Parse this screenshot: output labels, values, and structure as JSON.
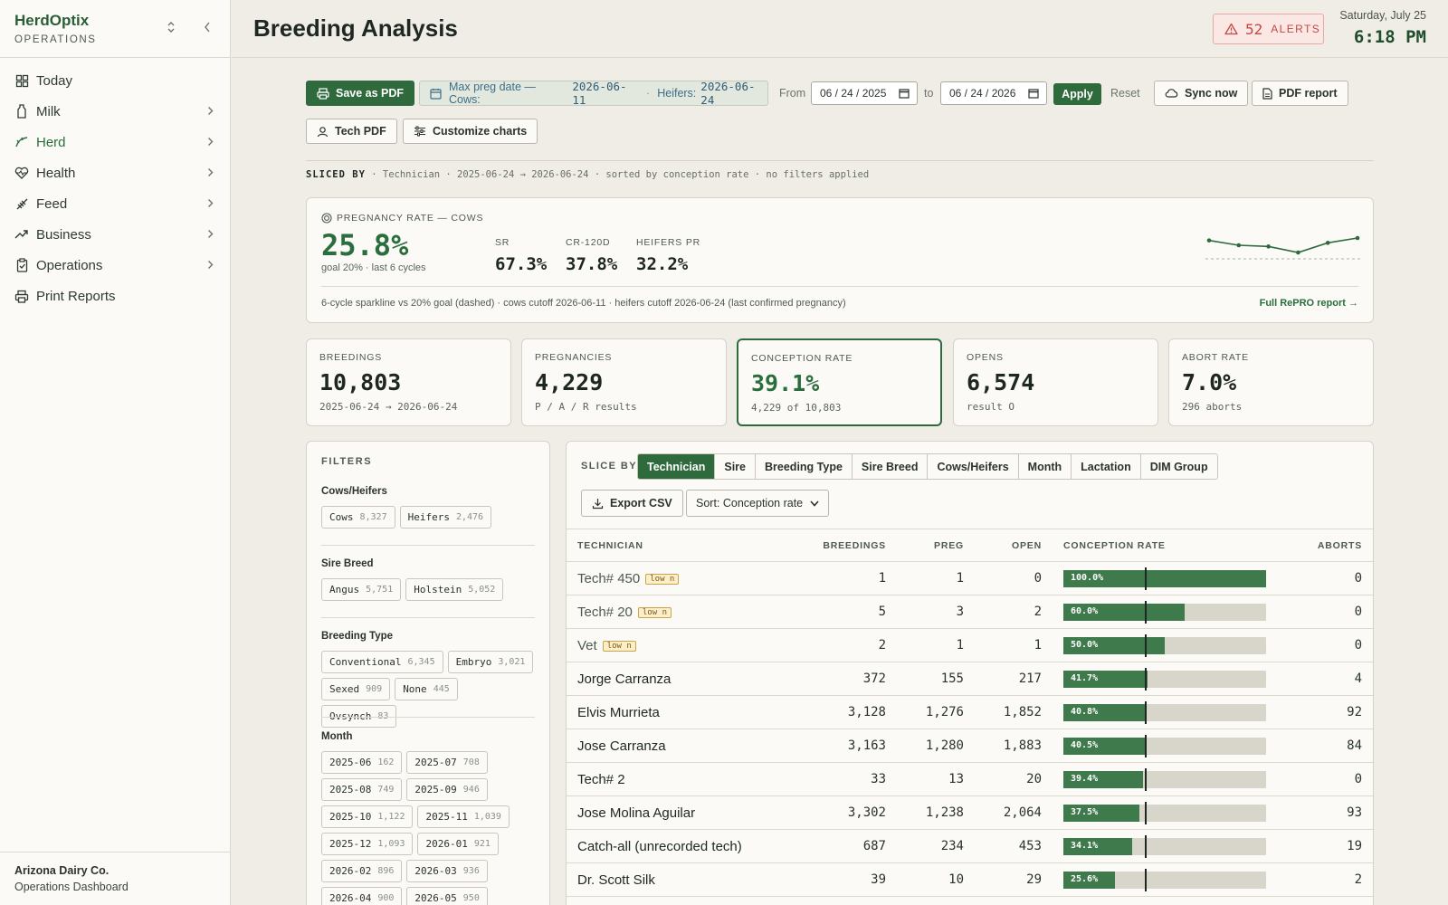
{
  "brand": {
    "name": "HerdOptix",
    "sub": "OPERATIONS"
  },
  "nav": [
    {
      "label": "Today",
      "icon": "layout-icon",
      "chevron": false,
      "active": false
    },
    {
      "label": "Milk",
      "icon": "milk-bottle-icon",
      "chevron": true,
      "active": false
    },
    {
      "label": "Herd",
      "icon": "herd-icon",
      "chevron": true,
      "active": true
    },
    {
      "label": "Health",
      "icon": "heart-pulse-icon",
      "chevron": true,
      "active": false
    },
    {
      "label": "Feed",
      "icon": "wheat-icon",
      "chevron": true,
      "active": false
    },
    {
      "label": "Business",
      "icon": "trend-up-icon",
      "chevron": true,
      "active": false
    },
    {
      "label": "Operations",
      "icon": "clipboard-check-icon",
      "chevron": true,
      "active": false
    },
    {
      "label": "Print Reports",
      "icon": "printer-icon",
      "chevron": false,
      "active": false
    }
  ],
  "footer": {
    "org": "Arizona Dairy Co.",
    "sub": "Operations Dashboard"
  },
  "header": {
    "title": "Breeding Analysis",
    "alerts_count": "52",
    "alerts_label": "ALERTS",
    "date": "Saturday, July 25",
    "time": "6:18 PM"
  },
  "toolbar": {
    "save_pdf": "Save as PDF",
    "maxpreg_label": "Max preg date — Cows:",
    "maxpreg_cows": "2026-06-11",
    "maxpreg_heifers_label": "Heifers:",
    "maxpreg_heifers": "2026-06-24",
    "from_label": "From",
    "from_value": "06 / 24 / 2025",
    "to_label": "to",
    "to_value": "06 / 24 / 2026",
    "apply": "Apply",
    "reset": "Reset",
    "sync": "Sync now",
    "pdf_report": "PDF report",
    "tech_pdf": "Tech PDF",
    "customize": "Customize charts"
  },
  "slice_caption": {
    "label": "SLICED BY",
    "text": " · Technician · 2025-06-24 → 2026-06-24 · sorted by conception rate · no filters applied"
  },
  "pregnancy": {
    "heading": "PREGNANCY RATE — COWS",
    "value": "25.8%",
    "goal": "goal 20% · last 6 cycles",
    "stats": [
      {
        "k": "SR",
        "v": "67.3%"
      },
      {
        "k": "CR-120D",
        "v": "37.8%"
      },
      {
        "k": "HEIFERS PR",
        "v": "32.2%"
      }
    ],
    "sparkline": [
      25.6,
      25.2,
      25.1,
      24.6,
      25.4,
      25.8
    ],
    "goal_pct": 20,
    "footnote": "6-cycle sparkline vs 20% goal (dashed) · cows cutoff 2026-06-11 · heifers cutoff 2026-06-24 (last confirmed pregnancy)",
    "link": "Full RePRO report →"
  },
  "kpis": [
    {
      "k": "BREEDINGS",
      "v": "10,803",
      "s": "2025-06-24 → 2026-06-24"
    },
    {
      "k": "PREGNANCIES",
      "v": "4,229",
      "s": "P / A / R results"
    },
    {
      "k": "CONCEPTION RATE",
      "v": "39.1%",
      "s": "4,229 of 10,803"
    },
    {
      "k": "OPENS",
      "v": "6,574",
      "s": "result O"
    },
    {
      "k": "ABORT RATE",
      "v": "7.0%",
      "s": "296 aborts"
    }
  ],
  "filters": {
    "title": "FILTERS",
    "sections": [
      {
        "h": "Cows/Heifers",
        "chips": [
          {
            "l": "Cows",
            "n": "8,327"
          },
          {
            "l": "Heifers",
            "n": "2,476"
          }
        ]
      },
      {
        "h": "Sire Breed",
        "chips": [
          {
            "l": "Angus",
            "n": "5,751"
          },
          {
            "l": "Holstein",
            "n": "5,052"
          }
        ]
      },
      {
        "h": "Breeding Type",
        "chips": [
          {
            "l": "Conventional",
            "n": "6,345"
          },
          {
            "l": "Embryo",
            "n": "3,021"
          },
          {
            "l": "Sexed",
            "n": "909"
          },
          {
            "l": "None",
            "n": "445"
          },
          {
            "l": "Ovsynch",
            "n": "83"
          }
        ]
      },
      {
        "h": "Month",
        "chips": [
          {
            "l": "2025-06",
            "n": "162"
          },
          {
            "l": "2025-07",
            "n": "708"
          },
          {
            "l": "2025-08",
            "n": "749"
          },
          {
            "l": "2025-09",
            "n": "946"
          },
          {
            "l": "2025-10",
            "n": "1,122"
          },
          {
            "l": "2025-11",
            "n": "1,039"
          },
          {
            "l": "2025-12",
            "n": "1,093"
          },
          {
            "l": "2026-01",
            "n": "921"
          },
          {
            "l": "2026-02",
            "n": "896"
          },
          {
            "l": "2026-03",
            "n": "936"
          },
          {
            "l": "2026-04",
            "n": "900"
          },
          {
            "l": "2026-05",
            "n": "950"
          }
        ]
      }
    ]
  },
  "slice": {
    "label": "SLICE BY",
    "options": [
      "Technician",
      "Sire",
      "Breeding Type",
      "Sire Breed",
      "Cows/Heifers",
      "Month",
      "Lactation",
      "DIM Group"
    ],
    "active": 0,
    "export": "Export CSV",
    "sort": "Sort: Conception rate"
  },
  "table": {
    "columns": [
      "TECHNICIAN",
      "BREEDINGS",
      "PREG",
      "OPEN",
      "CONCEPTION RATE",
      "ABORTS"
    ],
    "goal_rate": 40,
    "low_n_label": "low n",
    "rows": [
      {
        "name": "Tech# 450",
        "low": true,
        "breedings": "1",
        "preg": "1",
        "open": "0",
        "rate": 100.0,
        "rate_label": "100.0%",
        "aborts": "0"
      },
      {
        "name": "Tech# 20",
        "low": true,
        "breedings": "5",
        "preg": "3",
        "open": "2",
        "rate": 60.0,
        "rate_label": "60.0%",
        "aborts": "0"
      },
      {
        "name": "Vet",
        "low": true,
        "breedings": "2",
        "preg": "1",
        "open": "1",
        "rate": 50.0,
        "rate_label": "50.0%",
        "aborts": "0"
      },
      {
        "name": "Jorge Carranza",
        "low": false,
        "breedings": "372",
        "preg": "155",
        "open": "217",
        "rate": 41.7,
        "rate_label": "41.7%",
        "aborts": "4"
      },
      {
        "name": "Elvis Murrieta",
        "low": false,
        "breedings": "3,128",
        "preg": "1,276",
        "open": "1,852",
        "rate": 40.8,
        "rate_label": "40.8%",
        "aborts": "92"
      },
      {
        "name": "Jose Carranza",
        "low": false,
        "breedings": "3,163",
        "preg": "1,280",
        "open": "1,883",
        "rate": 40.5,
        "rate_label": "40.5%",
        "aborts": "84"
      },
      {
        "name": "Tech# 2",
        "low": false,
        "breedings": "33",
        "preg": "13",
        "open": "20",
        "rate": 39.4,
        "rate_label": "39.4%",
        "aborts": "0"
      },
      {
        "name": "Jose Molina Aguilar",
        "low": false,
        "breedings": "3,302",
        "preg": "1,238",
        "open": "2,064",
        "rate": 37.5,
        "rate_label": "37.5%",
        "aborts": "93"
      },
      {
        "name": "Catch-all (unrecorded tech)",
        "low": false,
        "breedings": "687",
        "preg": "234",
        "open": "453",
        "rate": 34.1,
        "rate_label": "34.1%",
        "aborts": "19"
      },
      {
        "name": "Dr. Scott Silk",
        "low": false,
        "breedings": "39",
        "preg": "10",
        "open": "29",
        "rate": 25.6,
        "rate_label": "25.6%",
        "aborts": "2"
      }
    ]
  },
  "colors": {
    "brand": "#2f6a3d",
    "alert": "#c04a43",
    "bar_fill": "#3e7a4c",
    "bar_track": "#d8d5ca"
  }
}
